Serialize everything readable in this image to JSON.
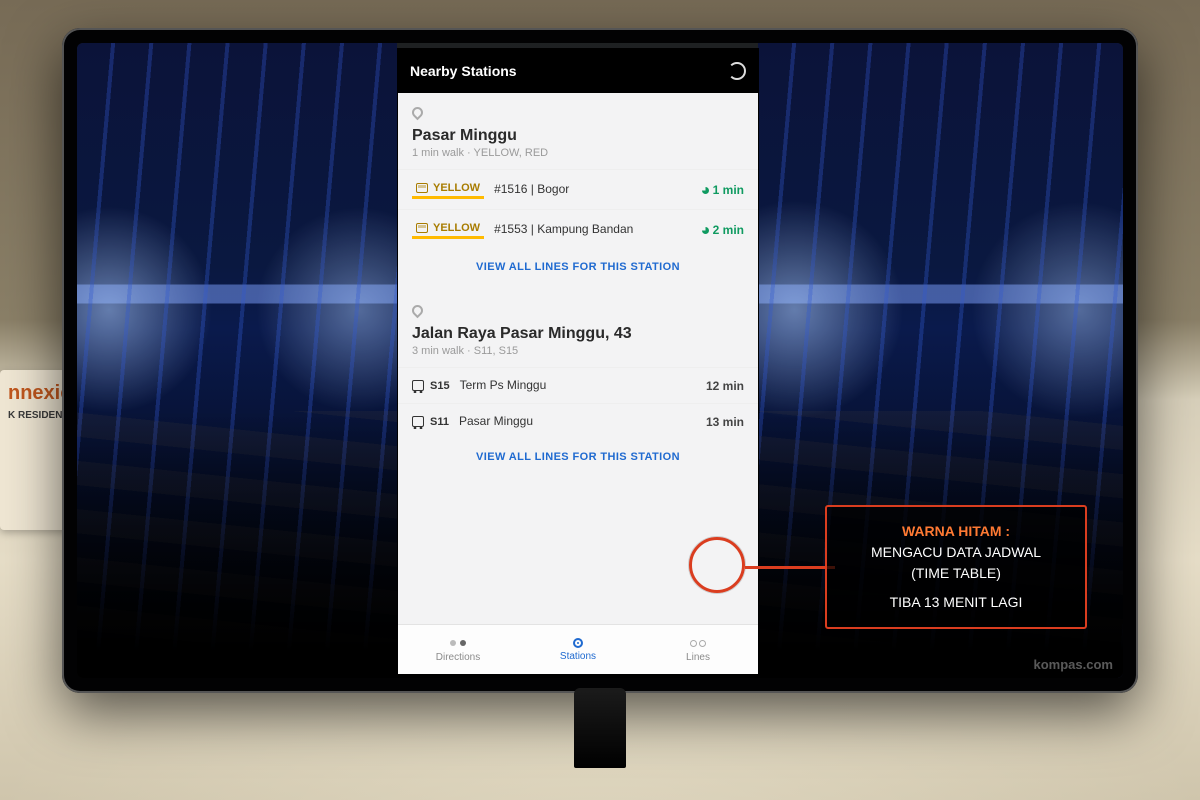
{
  "titlebar": {
    "title": "Nearby Stations"
  },
  "station1": {
    "name": "Pasar Minggu",
    "sub": "1 min walk · YELLOW, RED",
    "dep1": {
      "line": "YELLOW",
      "dest": "#1516 | Bogor",
      "eta": "1 min"
    },
    "dep2": {
      "line": "YELLOW",
      "dest": "#1553 | Kampung Bandan",
      "eta": "2 min"
    },
    "viewall": "VIEW ALL LINES FOR THIS STATION"
  },
  "station2": {
    "name": "Jalan Raya Pasar Minggu, 43",
    "sub": "3 min walk · S11, S15",
    "dep1": {
      "line": "S15",
      "dest": "Term Ps Minggu",
      "eta": "12 min"
    },
    "dep2": {
      "line": "S11",
      "dest": "Pasar Minggu",
      "eta": "13 min"
    },
    "viewall": "VIEW ALL LINES FOR THIS STATION"
  },
  "nav": {
    "directions": "Directions",
    "stations": "Stations",
    "lines": "Lines"
  },
  "annotation": {
    "heading": "WARNA HITAM :",
    "line1": "MENGACU DATA JADWAL",
    "line2": "(TIME TABLE)",
    "line3": "TIBA 13 MENIT LAGI"
  },
  "left_banner": {
    "brand": "nnexio",
    "sub": "K RESIDEN"
  },
  "watermark": "kompas.com"
}
